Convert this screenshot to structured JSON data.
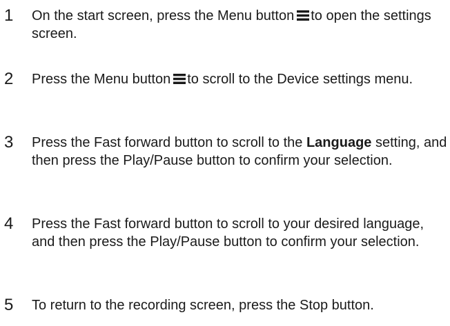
{
  "steps": [
    {
      "number": "1",
      "text_before_icon": "On the start screen, press the Menu button",
      "icon": "menu-icon",
      "text_after_icon": "to open the settings screen."
    },
    {
      "number": "2",
      "text_before_icon": "Press the Menu button",
      "icon": "menu-icon",
      "text_after_icon": "to scroll to the Device settings menu."
    },
    {
      "number": "3",
      "text_before_bold": "Press the Fast forward button to scroll to the",
      "bold": "Language",
      "text_after_bold": "setting, and then press the Play/Pause button to confirm your selection."
    },
    {
      "number": "4",
      "text": "Press the Fast forward button to scroll to your desired language, and then press the Play/Pause button to confirm your selection."
    },
    {
      "number": "5",
      "text": "To return to the recording screen, press the Stop button."
    }
  ]
}
